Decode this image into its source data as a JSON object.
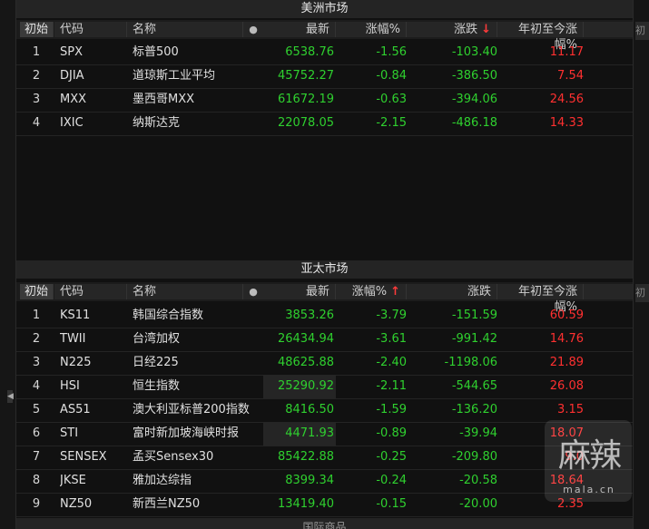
{
  "americas": {
    "title": "美洲市场",
    "header": {
      "reset": "初始",
      "code": "代码",
      "name": "名称",
      "latest": "最新",
      "pct": "涨幅%",
      "chg": "涨跌",
      "ytd": "年初至今涨幅%"
    },
    "rows": [
      {
        "idx": "1",
        "code": "SPX",
        "name": "标普500",
        "latest": "6538.76",
        "pct": "-1.56",
        "chg": "-103.40",
        "ytd": "11.17"
      },
      {
        "idx": "2",
        "code": "DJIA",
        "name": "道琼斯工业平均",
        "latest": "45752.27",
        "pct": "-0.84",
        "chg": "-386.50",
        "ytd": "7.54"
      },
      {
        "idx": "3",
        "code": "MXX",
        "name": "墨西哥MXX",
        "latest": "61672.19",
        "pct": "-0.63",
        "chg": "-394.06",
        "ytd": "24.56"
      },
      {
        "idx": "4",
        "code": "IXIC",
        "name": "纳斯达克",
        "latest": "22078.05",
        "pct": "-2.15",
        "chg": "-486.18",
        "ytd": "14.33"
      }
    ]
  },
  "asia": {
    "title": "亚太市场",
    "header": {
      "reset": "初始",
      "code": "代码",
      "name": "名称",
      "latest": "最新",
      "pct": "涨幅%",
      "chg": "涨跌",
      "ytd": "年初至今涨幅%"
    },
    "rows": [
      {
        "idx": "1",
        "code": "KS11",
        "name": "韩国综合指数",
        "latest": "3853.26",
        "pct": "-3.79",
        "chg": "-151.59",
        "ytd": "60.59"
      },
      {
        "idx": "2",
        "code": "TWII",
        "name": "台湾加权",
        "latest": "26434.94",
        "pct": "-3.61",
        "chg": "-991.42",
        "ytd": "14.76"
      },
      {
        "idx": "3",
        "code": "N225",
        "name": "日经225",
        "latest": "48625.88",
        "pct": "-2.40",
        "chg": "-1198.06",
        "ytd": "21.89"
      },
      {
        "idx": "4",
        "code": "HSI",
        "name": "恒生指数",
        "latest": "25290.92",
        "pct": "-2.11",
        "chg": "-544.65",
        "ytd": "26.08"
      },
      {
        "idx": "5",
        "code": "AS51",
        "name": "澳大利亚标普200指数",
        "latest": "8416.50",
        "pct": "-1.59",
        "chg": "-136.20",
        "ytd": "3.15"
      },
      {
        "idx": "6",
        "code": "STI",
        "name": "富时新加坡海峡时报",
        "latest": "4471.93",
        "pct": "-0.89",
        "chg": "-39.94",
        "ytd": "18.07"
      },
      {
        "idx": "7",
        "code": "SENSEX",
        "name": "孟买Sensex30",
        "latest": "85422.88",
        "pct": "-0.25",
        "chg": "-209.80",
        "ytd": "9.0"
      },
      {
        "idx": "8",
        "code": "JKSE",
        "name": "雅加达综指",
        "latest": "8399.34",
        "pct": "-0.24",
        "chg": "-20.58",
        "ytd": "18.64"
      },
      {
        "idx": "9",
        "code": "NZ50",
        "name": "新西兰NZ50",
        "latest": "13419.40",
        "pct": "-0.15",
        "chg": "-20.00",
        "ytd": "2.35"
      }
    ]
  },
  "next_section": {
    "title": "国际商品"
  },
  "right_stub": {
    "label": "初"
  },
  "watermark": {
    "main": "麻辣",
    "sub": "mala.cn"
  },
  "colors": {
    "up": "#ff3030",
    "down": "#2fd02f",
    "sort_arrow": "#ff3b3b"
  },
  "sort": {
    "americas_column": "chg",
    "americas_dir": "down",
    "asia_column": "pct",
    "asia_dir": "up"
  }
}
